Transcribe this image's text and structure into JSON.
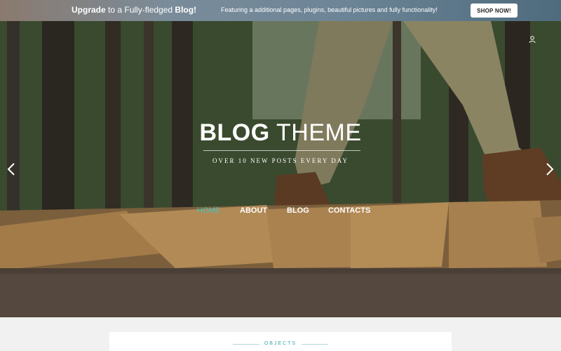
{
  "promo": {
    "upgrade": "Upgrade",
    "to_a": " to a Fully-fledged ",
    "blog": "Blog!",
    "feature_text": "Featuring a additional pages, plugins, beautiful pictures and fully functionality!",
    "shop_button": "SHOP NOW!"
  },
  "hero": {
    "title_bold": "BLOG",
    "title_light": " THEME",
    "subtitle": "OVER 10 NEW POSTS EVERY DAY"
  },
  "nav": {
    "items": [
      {
        "label": "HOME"
      },
      {
        "label": "ABOUT"
      },
      {
        "label": "BLOG"
      },
      {
        "label": "CONTACTS"
      }
    ]
  },
  "section": {
    "label": "OBJECTS"
  },
  "colors": {
    "accent": "#3fc2c0",
    "promo_text": "#ffffff"
  },
  "icons": [
    "user-icon",
    "arrow-left-icon",
    "arrow-right-icon"
  ]
}
